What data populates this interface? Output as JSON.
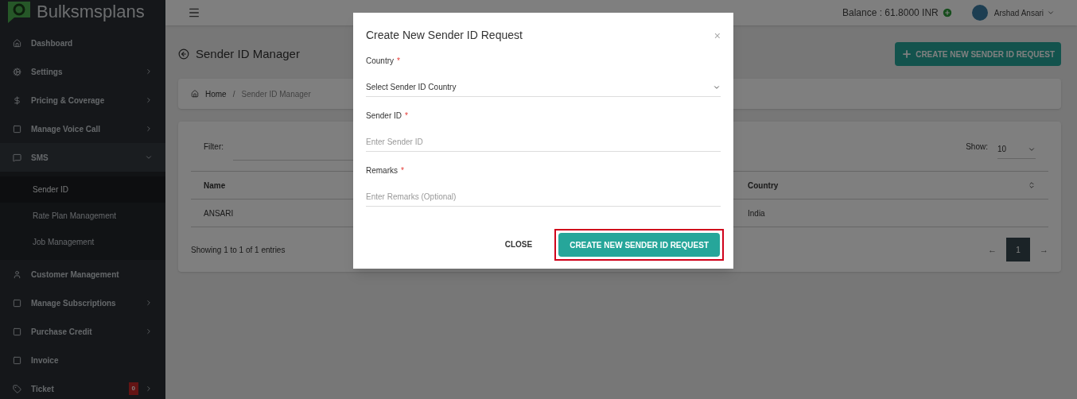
{
  "logo": {
    "text": "Bulksmsplans"
  },
  "header": {
    "balance": "Balance : 61.8000 INR",
    "user": "Arshad Ansari"
  },
  "sidebar": {
    "items": [
      {
        "label": "Dashboard",
        "submenu": false,
        "expanded": false
      },
      {
        "label": "Settings",
        "submenu": true,
        "expanded": false
      },
      {
        "label": "Pricing & Coverage",
        "submenu": true,
        "expanded": false
      },
      {
        "label": "Manage Voice Call",
        "submenu": true,
        "expanded": false
      },
      {
        "label": "SMS",
        "submenu": true,
        "expanded": true,
        "children": [
          {
            "label": "Sender ID",
            "selected": true
          },
          {
            "label": "Rate Plan Management",
            "selected": false
          },
          {
            "label": "Job Management",
            "selected": false
          }
        ]
      },
      {
        "label": "Customer Management",
        "submenu": false,
        "expanded": false
      },
      {
        "label": "Manage Subscriptions",
        "submenu": true,
        "expanded": false
      },
      {
        "label": "Purchase Credit",
        "submenu": true,
        "expanded": false
      },
      {
        "label": "Invoice",
        "submenu": false,
        "expanded": false
      },
      {
        "label": "Ticket",
        "submenu": true,
        "expanded": false,
        "badge": "0"
      }
    ]
  },
  "page": {
    "title": "Sender ID Manager",
    "create_button": "CREATE NEW SENDER ID REQUEST",
    "breadcrumb": [
      "Home",
      "Sender ID Manager"
    ],
    "breadcrumb_separator": "/"
  },
  "table": {
    "filter_label": "Filter:",
    "show_label": "Show:",
    "page_size": "10",
    "columns": [
      "Name",
      "Country"
    ],
    "rows": [
      [
        "ANSARI",
        "India"
      ]
    ],
    "info": "Showing 1 to 1 of 1 entries",
    "prev": "←",
    "next": "→",
    "pages": [
      {
        "label": "1",
        "selected": true
      }
    ]
  },
  "modal": {
    "title": "Create New Sender ID Request",
    "close_icon": "×",
    "fields": [
      {
        "kind": "select",
        "label": "Country",
        "required_mark": "*",
        "value": "Select Sender ID Country"
      },
      {
        "kind": "text",
        "label": "Sender ID",
        "required_mark": "*",
        "placeholder": "Enter Sender ID"
      },
      {
        "kind": "text",
        "label": "Remarks",
        "required_mark": "*",
        "placeholder": "Enter Remarks (Optional)"
      }
    ],
    "close_button": "CLOSE",
    "submit_button": "CREATE NEW SENDER ID REQUEST",
    "submit_highlighted": true
  }
}
